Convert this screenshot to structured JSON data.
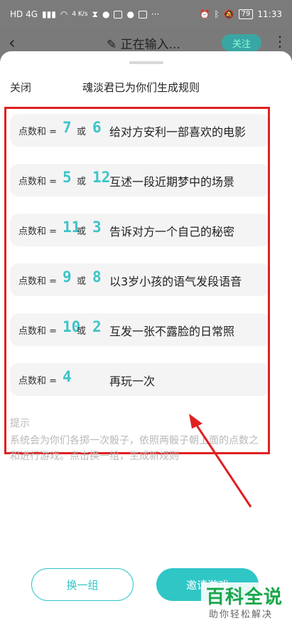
{
  "status_bar": {
    "left_text": "HD 4G",
    "speed": "4 K/s",
    "more": "···",
    "battery": "79",
    "time": "11:33"
  },
  "behind": {
    "back_icon": "chevron-left-icon",
    "title": "✎ 正在输入...",
    "follow_label": "关注",
    "more_icon": "more-vertical-icon"
  },
  "sheet": {
    "close_label": "关闭",
    "title": "魂淡君已为你们生成规则",
    "rules": [
      {
        "prefix": "点数和 =",
        "a": "7",
        "or": "或",
        "b": "6",
        "text": "给对方安利一部喜欢的电影"
      },
      {
        "prefix": "点数和 =",
        "a": "5",
        "or": "或",
        "b": "12",
        "text": "互述一段近期梦中的场景"
      },
      {
        "prefix": "点数和 =",
        "a": "11",
        "or": "或",
        "b": "3",
        "text": "告诉对方一个自己的秘密"
      },
      {
        "prefix": "点数和 =",
        "a": "9",
        "or": "或",
        "b": "8",
        "text": "以3岁小孩的语气发段语音"
      },
      {
        "prefix": "点数和 =",
        "a": "10",
        "or": "或",
        "b": "2",
        "text": "互发一张不露脸的日常照"
      },
      {
        "prefix": "点数和 =",
        "a": "4",
        "or": "",
        "b": "",
        "text": "再玩一次"
      }
    ],
    "tips_label": "提示",
    "tips_text": "系统会为你们各掷一次骰子，依照两骰子朝上面的点数之和进行游戏。点击换一组，生成新规则",
    "change_label": "换一组",
    "invite_label": "邀请游戏"
  },
  "watermark": {
    "main": "百科全说",
    "sub": "助你轻松解决"
  },
  "colors": {
    "accent": "#30c6c6",
    "number": "#3cc4c8",
    "annotation": "#e02020",
    "watermark": "#1aa64b"
  }
}
